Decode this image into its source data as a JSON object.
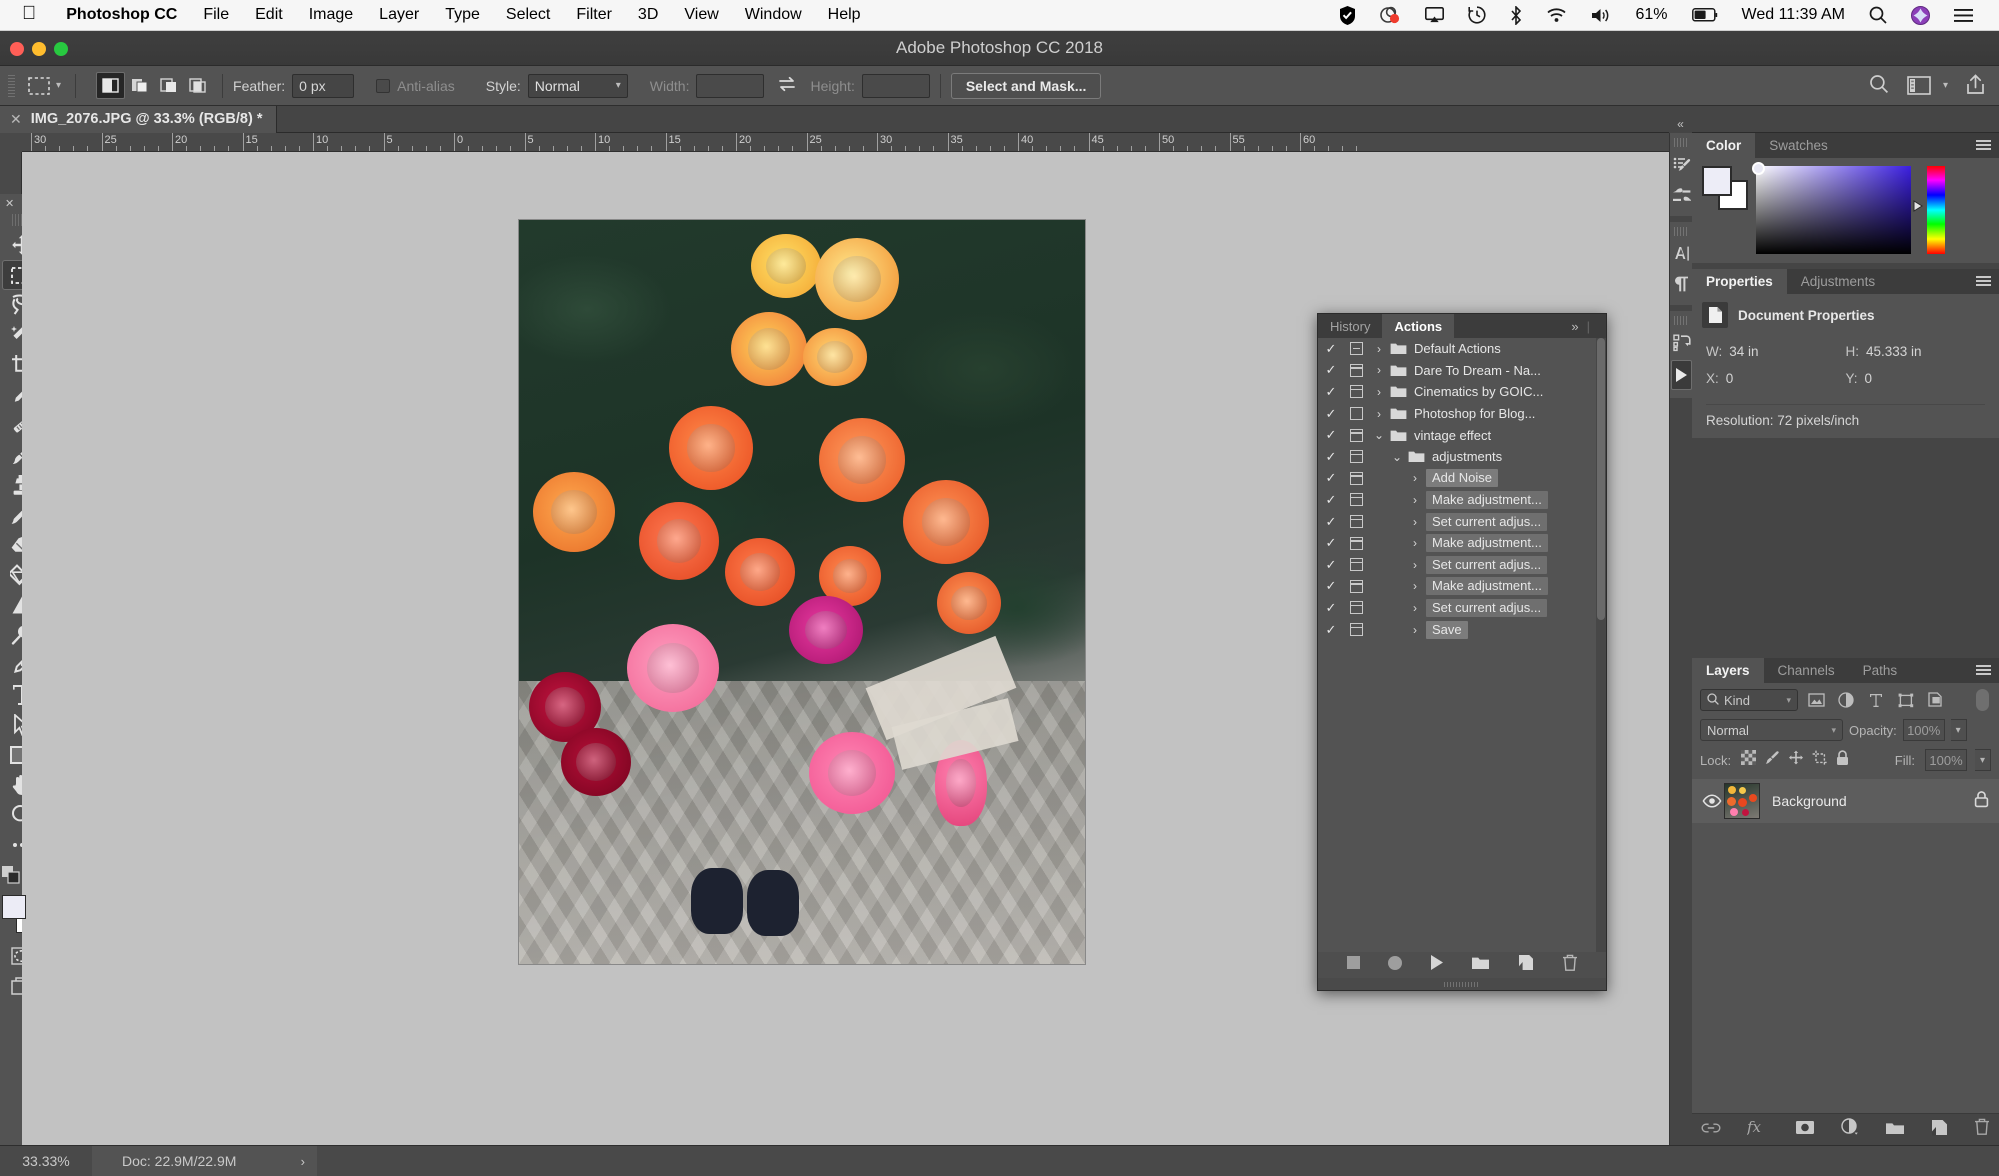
{
  "menubar": {
    "apple_icon": "apple-icon",
    "app_name": "Photoshop CC",
    "items": [
      "File",
      "Edit",
      "Image",
      "Layer",
      "Type",
      "Select",
      "Filter",
      "3D",
      "View",
      "Window",
      "Help"
    ],
    "status_icons": [
      "shield-icon",
      "color-blob-icon",
      "airplay-icon",
      "time-machine-icon",
      "bluetooth-icon",
      "wifi-icon",
      "volume-icon"
    ],
    "battery_percent": "61%",
    "clock": "Wed 11:39 AM",
    "right_icons": [
      "spotlight-search-icon",
      "siri-icon",
      "control-center-icon"
    ]
  },
  "titlebar": {
    "title": "Adobe Photoshop CC 2018"
  },
  "options_bar": {
    "tool_icon": "rectangular-marquee-icon",
    "selection_modes": [
      "new-selection",
      "add-to-selection",
      "subtract-from-selection",
      "intersect-with-selection"
    ],
    "feather_label": "Feather:",
    "feather_value": "0 px",
    "antialias_label": "Anti-alias",
    "style_label": "Style:",
    "style_value": "Normal",
    "width_label": "Width:",
    "width_value": "",
    "swap_icon": "swap-arrows-icon",
    "height_label": "Height:",
    "height_value": "",
    "select_and_mask_label": "Select and Mask...",
    "right_icons": [
      "search-icon",
      "workspace-icon",
      "chevron-down-icon",
      "share-icon"
    ]
  },
  "document_tab": {
    "close_icon": "close-icon",
    "title": "IMG_2076.JPG @ 33.3% (RGB/8) *"
  },
  "ruler": {
    "labels": [
      "30",
      "25",
      "20",
      "15",
      "10",
      "5",
      "0",
      "5",
      "10",
      "15",
      "20",
      "25",
      "30",
      "35",
      "40",
      "45",
      "50",
      "55",
      "60"
    ]
  },
  "toolbar": {
    "close_icon": "close-icon",
    "expand_icon": "expand-icon",
    "tools": [
      {
        "name": "move-tool",
        "icon": "move-icon",
        "active": false
      },
      {
        "name": "rectangular-marquee-tool",
        "icon": "marquee-icon",
        "active": true
      },
      {
        "name": "lasso-tool",
        "icon": "lasso-icon",
        "active": false
      },
      {
        "name": "quick-selection-tool",
        "icon": "magic-wand-icon",
        "active": false
      },
      {
        "name": "crop-tool",
        "icon": "crop-icon",
        "active": false
      },
      {
        "name": "eyedropper-tool",
        "icon": "eyedropper-icon",
        "active": false
      },
      {
        "name": "spot-healing-brush-tool",
        "icon": "healing-brush-icon",
        "active": false
      },
      {
        "name": "brush-tool",
        "icon": "brush-icon",
        "active": false
      },
      {
        "name": "clone-stamp-tool",
        "icon": "stamp-icon",
        "active": false
      },
      {
        "name": "history-brush-tool",
        "icon": "history-brush-icon",
        "active": false
      },
      {
        "name": "eraser-tool",
        "icon": "eraser-icon",
        "active": false
      },
      {
        "name": "gradient-tool",
        "icon": "paint-bucket-icon",
        "active": false
      },
      {
        "name": "blur-tool",
        "icon": "blur-triangle-icon",
        "active": false
      },
      {
        "name": "dodge-tool",
        "icon": "dodge-icon",
        "active": false
      },
      {
        "name": "pen-tool",
        "icon": "pen-icon",
        "active": false
      },
      {
        "name": "type-tool",
        "icon": "type-t-icon",
        "active": false
      },
      {
        "name": "path-selection-tool",
        "icon": "arrow-cursor-icon",
        "active": false
      },
      {
        "name": "rectangle-tool",
        "icon": "rectangle-icon",
        "active": false
      },
      {
        "name": "hand-tool",
        "icon": "hand-icon",
        "active": false
      },
      {
        "name": "zoom-tool",
        "icon": "magnifier-icon",
        "active": false
      },
      {
        "name": "edit-toolbar",
        "icon": "ellipsis-icon",
        "active": false
      }
    ],
    "default_colors_icon": "default-colors-icon",
    "swap_colors_icon": "swap-colors-icon",
    "foreground_color": "#ececf6",
    "background_color": "#ffffff",
    "quick_mask_icon": "quick-mask-icon",
    "screen_mode_icon": "screen-mode-icon"
  },
  "status_bar": {
    "zoom": "33.33%",
    "doc": "Doc: 22.9M/22.9M",
    "arrow_icon": "chevron-right-icon"
  },
  "icon_dock": {
    "collapse_icon": "double-chevron-left-icon",
    "groups": [
      [
        "brush-presets-icon",
        "brush-settings-icon"
      ],
      [
        "character-icon",
        "paragraph-icon"
      ],
      [
        "actions-mini-icon",
        "play-icon"
      ]
    ]
  },
  "color_panel": {
    "tabs": [
      {
        "label": "Color",
        "active": true
      },
      {
        "label": "Swatches",
        "active": false
      }
    ],
    "menu_icon": "panel-menu-icon",
    "foreground_color": "#ededf7",
    "background_color": "#ffffff",
    "hue_marker_icon": "hue-slider-marker"
  },
  "properties_panel": {
    "tabs": [
      {
        "label": "Properties",
        "active": true
      },
      {
        "label": "Adjustments",
        "active": false
      }
    ],
    "menu_icon": "panel-menu-icon",
    "header_icon": "document-icon",
    "header_title": "Document Properties",
    "fields": [
      {
        "key": "W:",
        "value": "34 in"
      },
      {
        "key": "H:",
        "value": "45.333 in"
      },
      {
        "key": "X:",
        "value": "0"
      },
      {
        "key": "Y:",
        "value": "0"
      }
    ],
    "resolution": "Resolution: 72 pixels/inch"
  },
  "layers_panel": {
    "tabs": [
      {
        "label": "Layers",
        "active": true
      },
      {
        "label": "Channels",
        "active": false
      },
      {
        "label": "Paths",
        "active": false
      }
    ],
    "menu_icon": "panel-menu-icon",
    "filter": {
      "search_icon": "search-icon",
      "kind_label": "Kind",
      "caret_icon": "chevron-down-icon",
      "filter_icons": [
        "pixel-layer-filter-icon",
        "adjustment-layer-filter-icon",
        "type-layer-filter-icon",
        "shape-layer-filter-icon",
        "smart-object-filter-icon"
      ],
      "toggle_icon": "filter-toggle-switch"
    },
    "blend_mode": "Normal",
    "opacity_label": "Opacity:",
    "opacity_value": "100%",
    "lock_label": "Lock:",
    "lock_icons": [
      "lock-transparent-pixels-icon",
      "lock-image-pixels-icon",
      "lock-position-icon",
      "lock-artboard-icon",
      "lock-all-icon"
    ],
    "fill_label": "Fill:",
    "fill_value": "100%",
    "layers": [
      {
        "name": "Background",
        "visible_icon": "eye-icon",
        "locked_icon": "lock-icon",
        "thumbnail": "roses-thumbnail"
      }
    ],
    "bottom_icons": [
      "link-layers-icon",
      "fx-icon",
      "add-layer-mask-icon",
      "new-adjustment-layer-icon",
      "new-group-icon",
      "new-layer-icon",
      "delete-layer-icon"
    ]
  },
  "actions_panel": {
    "tabs": [
      {
        "label": "History",
        "active": false
      },
      {
        "label": "Actions",
        "active": true
      }
    ],
    "expand_icon": "double-chevron-right-icon",
    "menu_icon": "panel-menu-icon",
    "rows": [
      {
        "checked": true,
        "box": "mod",
        "arrow": "chevron-right-icon",
        "folder": true,
        "indent": 0,
        "label": "Default Actions",
        "type": "set",
        "selected": false
      },
      {
        "checked": true,
        "box": "line",
        "arrow": "chevron-right-icon",
        "folder": true,
        "indent": 0,
        "label": "Dare To Dream - Na...",
        "type": "set",
        "selected": false
      },
      {
        "checked": true,
        "box": "line",
        "arrow": "chevron-right-icon",
        "folder": true,
        "indent": 0,
        "label": "Cinematics by GOIC...",
        "type": "set",
        "selected": false
      },
      {
        "checked": true,
        "box": "empty",
        "arrow": "chevron-right-icon",
        "folder": true,
        "indent": 0,
        "label": "Photoshop for Blog...",
        "type": "set",
        "selected": false
      },
      {
        "checked": true,
        "box": "line",
        "arrow": "chevron-down-icon",
        "folder": true,
        "indent": 0,
        "label": "vintage effect",
        "type": "set",
        "selected": false
      },
      {
        "checked": true,
        "box": "line",
        "arrow": "chevron-down-icon",
        "folder": true,
        "indent": 1,
        "label": "adjustments",
        "type": "action",
        "selected": false
      },
      {
        "checked": true,
        "box": "line",
        "arrow": "chevron-right-icon",
        "folder": false,
        "indent": 2,
        "label": "Add Noise",
        "type": "command",
        "selected": true
      },
      {
        "checked": true,
        "box": "line",
        "arrow": "chevron-right-icon",
        "folder": false,
        "indent": 2,
        "label": "Make adjustment...",
        "type": "command",
        "selected": false
      },
      {
        "checked": true,
        "box": "line",
        "arrow": "chevron-right-icon",
        "folder": false,
        "indent": 2,
        "label": "Set current adjus...",
        "type": "command",
        "selected": false
      },
      {
        "checked": true,
        "box": "line",
        "arrow": "chevron-right-icon",
        "folder": false,
        "indent": 2,
        "label": "Make adjustment...",
        "type": "command",
        "selected": false
      },
      {
        "checked": true,
        "box": "line",
        "arrow": "chevron-right-icon",
        "folder": false,
        "indent": 2,
        "label": "Set current adjus...",
        "type": "command",
        "selected": false
      },
      {
        "checked": true,
        "box": "line",
        "arrow": "chevron-right-icon",
        "folder": false,
        "indent": 2,
        "label": "Make adjustment...",
        "type": "command",
        "selected": false
      },
      {
        "checked": true,
        "box": "line",
        "arrow": "chevron-right-icon",
        "folder": false,
        "indent": 2,
        "label": "Set current adjus...",
        "type": "command",
        "selected": false
      },
      {
        "checked": true,
        "box": "line",
        "arrow": "chevron-right-icon",
        "folder": false,
        "indent": 2,
        "label": "Save",
        "type": "command",
        "selected": true
      }
    ],
    "bottom_icons": [
      "stop-recording-icon",
      "begin-recording-icon",
      "play-selection-icon",
      "new-set-icon",
      "new-action-icon",
      "delete-icon"
    ]
  },
  "canvas": {
    "document_name": "IMG_2076.JPG",
    "zoom": "33.33%",
    "image_description": "roses-photograph"
  }
}
